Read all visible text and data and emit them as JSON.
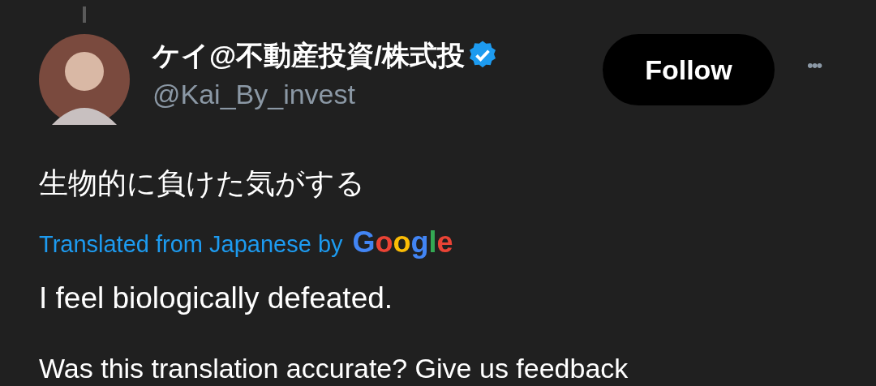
{
  "author": {
    "name": "ケイ@不動産投資/株式投",
    "handle": "@Kai_By_invest",
    "verified": true
  },
  "follow_button": "Follow",
  "more_button": "•••",
  "tweet_text": "生物的に負けた気がする",
  "translation": {
    "label": "Translated from Japanese by",
    "provider": "Google",
    "text": "I feel biologically defeated.",
    "feedback": "Was this translation accurate? Give us feedback"
  }
}
